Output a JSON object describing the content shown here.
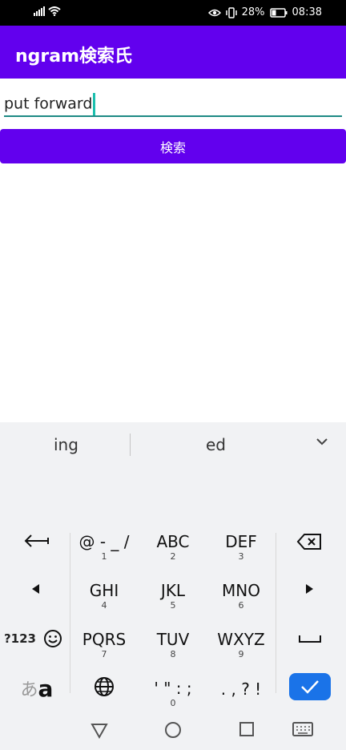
{
  "status": {
    "battery": "28%",
    "time": "08:38"
  },
  "app": {
    "title": "ngram検索氏"
  },
  "search": {
    "value": "put forward",
    "button_label": "検索"
  },
  "suggestions": {
    "left": "ing",
    "right": "ed"
  },
  "keyboard": {
    "keys": {
      "sym": {
        "main": "@ - _ /",
        "sub": "1"
      },
      "abc": {
        "main": "ABC",
        "sub": "2"
      },
      "def": {
        "main": "DEF",
        "sub": "3"
      },
      "ghi": {
        "main": "GHI",
        "sub": "4"
      },
      "jkl": {
        "main": "JKL",
        "sub": "5"
      },
      "mno": {
        "main": "MNO",
        "sub": "6"
      },
      "pqrs": {
        "main": "PQRS",
        "sub": "7"
      },
      "tuv": {
        "main": "TUV",
        "sub": "8"
      },
      "wxyz": {
        "main": "WXYZ",
        "sub": "9"
      },
      "quote": {
        "main": "' \" : ;",
        "sub": "0"
      },
      "punct": {
        "main": ". , ? !"
      },
      "num_toggle": "?123",
      "kana_a": "あ",
      "latin_a": "a"
    }
  },
  "colors": {
    "primary": "#6200ee",
    "accent_underline": "#1e8a84",
    "confirm": "#1a73e8"
  }
}
